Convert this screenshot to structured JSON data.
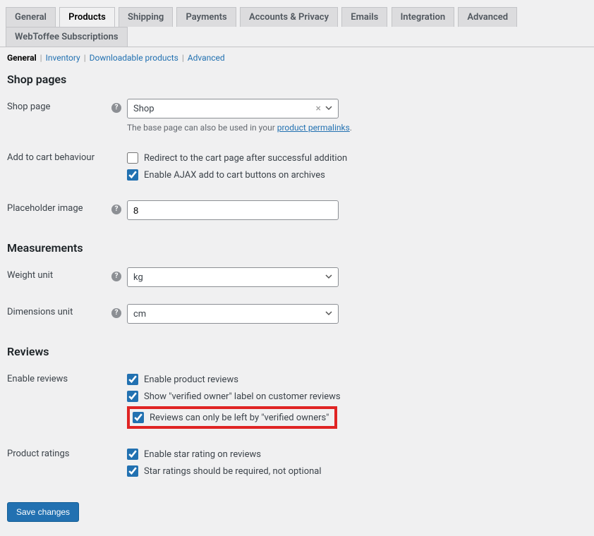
{
  "tabs": {
    "general": "General",
    "products": "Products",
    "shipping": "Shipping",
    "payments": "Payments",
    "accounts": "Accounts & Privacy",
    "emails": "Emails",
    "integration": "Integration",
    "advanced": "Advanced",
    "webtoffee": "WebToffee Subscriptions"
  },
  "subnav": {
    "general": "General",
    "inventory": "Inventory",
    "downloadable": "Downloadable products",
    "advanced": "Advanced"
  },
  "sections": {
    "shop_pages": "Shop pages",
    "measurements": "Measurements",
    "reviews": "Reviews"
  },
  "labels": {
    "shop_page": "Shop page",
    "add_to_cart": "Add to cart behaviour",
    "placeholder_image": "Placeholder image",
    "weight_unit": "Weight unit",
    "dimensions_unit": "Dimensions unit",
    "enable_reviews": "Enable reviews",
    "product_ratings": "Product ratings"
  },
  "fields": {
    "shop_page_value": "Shop",
    "base_page_desc_pre": "The base page can also be used in your ",
    "base_page_link": "product permalinks",
    "base_page_desc_post": ".",
    "redirect": "Redirect to the cart page after successful addition",
    "ajax": "Enable AJAX add to cart buttons on archives",
    "placeholder_value": "8",
    "weight_value": "kg",
    "dimensions_value": "cm",
    "enable_product_reviews": "Enable product reviews",
    "verified_owner_label": "Show \"verified owner\" label on customer reviews",
    "verified_only": "Reviews can only be left by \"verified owners\"",
    "star_rating": "Enable star rating on reviews",
    "star_required": "Star ratings should be required, not optional"
  },
  "buttons": {
    "save": "Save changes"
  },
  "glyphs": {
    "help": "?",
    "clear": "×"
  }
}
